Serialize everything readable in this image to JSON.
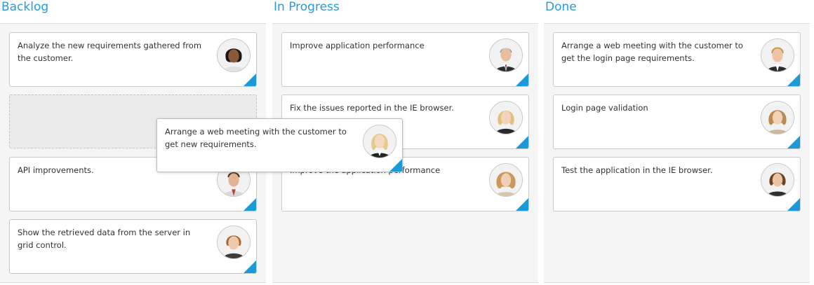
{
  "accent_color": "#1c99d8",
  "title_color": "#2b9ad8",
  "columns": [
    {
      "title": "Backlog",
      "cards": [
        {
          "text": "Analyze the new requirements gathered from the customer.",
          "avatar": "woman-dark-hair-avatar"
        },
        {
          "text": "API improvements.",
          "avatar": "man-smiling-avatar"
        },
        {
          "text": "Show the retrieved data from the server in grid control.",
          "avatar": "woman-short-hair-avatar"
        }
      ]
    },
    {
      "title": "In Progress",
      "cards": [
        {
          "text": "Improve application performance",
          "avatar": "man-suit-avatar"
        },
        {
          "text": "Fix the issues reported in the IE browser.",
          "avatar": "woman-blonde-avatar"
        },
        {
          "text": "Improve the application performance",
          "avatar": "woman-curly-hair-avatar"
        }
      ]
    },
    {
      "title": "Done",
      "cards": [
        {
          "text": "Arrange a web meeting with the customer to get the login page requirements.",
          "avatar": "man-blond-avatar"
        },
        {
          "text": "Login page validation",
          "avatar": "woman-wavy-hair-avatar"
        },
        {
          "text": "Test the application in the IE browser.",
          "avatar": "woman-brown-hair-avatar"
        }
      ]
    }
  ],
  "dragging_card": {
    "text": "Arrange a web meeting with the customer to get new requirements.",
    "avatar": "woman-blonde-avatar"
  }
}
